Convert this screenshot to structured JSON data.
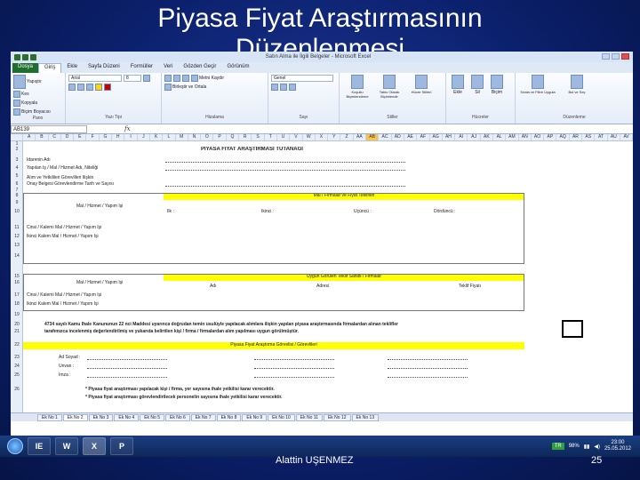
{
  "slide": {
    "title": "Piyasa Fiyat Araştırmasının\nDüzenlenmesi",
    "author": "Alattin UŞENMEZ",
    "page_number": "25"
  },
  "excel": {
    "window_title": "Satın Alma ile İlgili Belgeler - Microsoft Excel",
    "tabs": [
      "Dosya",
      "Giriş",
      "Ekle",
      "Sayfa Düzeni",
      "Formüller",
      "Veri",
      "Gözden Geçir",
      "Görünüm"
    ],
    "active_tab": "Giriş",
    "ribbon_groups": [
      {
        "name": "Pano",
        "items": [
          "Kes",
          "Kopyala",
          "Biçim Boyacısı"
        ],
        "paste": "Yapıştır"
      },
      {
        "name": "Yazı Tipi",
        "font": "Arial",
        "size": "8"
      },
      {
        "name": "Hizalama",
        "items": [
          "Metni Kaydır",
          "Birleştir ve Ortala"
        ]
      },
      {
        "name": "Sayı",
        "format": "Genel"
      },
      {
        "name": "Stiller",
        "items": [
          "Koşullu Biçimlendirme",
          "Tablo Olarak Biçimlendir",
          "Hücre Stilleri"
        ]
      },
      {
        "name": "Hücreler",
        "items": [
          "Ekle",
          "Sil",
          "Biçim"
        ]
      },
      {
        "name": "Düzenleme",
        "items": [
          "Sırala ve Filtre Uygula",
          "Bul ve Seç"
        ]
      }
    ],
    "name_box": "AB139",
    "formula_symbol": "fx",
    "columns": [
      "A",
      "B",
      "C",
      "D",
      "E",
      "F",
      "G",
      "H",
      "I",
      "J",
      "K",
      "L",
      "M",
      "N",
      "O",
      "P",
      "Q",
      "R",
      "S",
      "T",
      "U",
      "V",
      "W",
      "X",
      "Y",
      "Z",
      "AA",
      "AB",
      "AC",
      "AD",
      "AE",
      "AF",
      "AG",
      "AH",
      "AI",
      "AJ",
      "AK",
      "AL",
      "AM",
      "AN",
      "AO",
      "AP",
      "AQ",
      "AR",
      "AS",
      "AT",
      "AU",
      "AV"
    ],
    "selected_column": "AB",
    "rows": [
      "1",
      "2",
      "3",
      "4",
      "5",
      "6",
      "7",
      "8",
      "9",
      "10",
      "11",
      "12",
      "13",
      "14",
      "15",
      "16",
      "17",
      "18",
      "19",
      "20",
      "21",
      "22",
      "23",
      "24",
      "25",
      "26"
    ],
    "form": {
      "title": "PİYASA FİYAT ARAŞTIRMASI TUTANAĞI",
      "idare_adi": "İdarenin Adı",
      "yapilan_is": "Yapılan İş / Mal / Hizmet Adı, Niteliği",
      "alim_yetkilileri": "Alım ve Yetkilileri Görevlileri İlişkin",
      "onay_belgesi": "Onay Belgesi Görevlendirme Tarih ve Sayısı",
      "teklifler_header": "Mal / Firmalar ve Fiyat Teklifleri",
      "mal_hizmet": "Mal / Hizmet / Yapım İşi",
      "birinci": "İlk :",
      "ikinci": "İkinci :",
      "ucuncu": "Üçüncü :",
      "dorduncu": "Dördüncü :",
      "item1": "Cinsi / Kalemi Mal / Hizmet / Yapım İşi",
      "item2": "İkinci Kalem Mal / Hizmet / Yapım İşi",
      "uygun_header": "Uygun Görülen Teklif Sahibi / Firmalar",
      "adi": "Adı",
      "adresi": "Adresi",
      "fiyat": "Teklif Fiyatı",
      "statement": "4734 sayılı Kamu İhale Kanununun 22 nci Maddesi uyarınca doğrudan temin usulüyle yapılacak alımlara ilişkin yapılan piyasa araştırmasında firmalardan alınan teklifler",
      "statement2": "tarafımızca incelenmiş değerlendirilmiş ve yukarıda belirtilen kişi / firma / firmalardan alım yapılması uygun görülmüştür.",
      "gorevli_header": "Piyasa Fiyat Araştırma Görevlisi / Görevlileri",
      "ad_soyad": "Ad Soyad :",
      "unvan": "Unvan :",
      "imza": "İmza :",
      "note1": "* Piyasa fiyat araştırması yapılacak kişi / firma, yer sayısına ihale yetkilisi karar verecektir.",
      "note2": "* Piyasa fiyat araştırması görevlendirilecek personelin sayısına ihale yetkilisi karar verecektir."
    },
    "sheet_tabs": [
      "Ek No 1",
      "Ek No 2",
      "Ek No 3",
      "Ek No 4",
      "Ek No 5",
      "Ek No 6",
      "Ek No 7",
      "Ek No 8",
      "Ek No 9",
      "Ek No 10",
      "Ek No 11",
      "Ek No 12",
      "Ek No 13"
    ],
    "active_sheet": "Ek No 2"
  },
  "taskbar": {
    "apps": [
      "IE",
      "W",
      "X",
      "P"
    ],
    "active_app": "X",
    "language": "TR",
    "zoom": "98%",
    "time": "23:00",
    "date": "25.05.2012"
  }
}
